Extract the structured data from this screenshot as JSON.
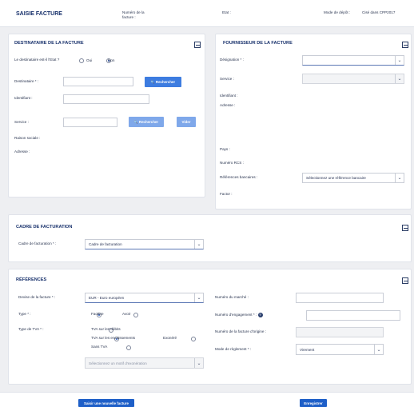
{
  "header": {
    "title": "SAISIE FACTURE",
    "invoice_number_label": "Numéro de la facture :",
    "status_label": "Etat :",
    "deposit_mode_label": "Mode de dépôt :",
    "deposit_mode_value": "Cisé dans CPP2017"
  },
  "destinataire": {
    "title": "DESTINATAIRE DE LA FACTURE",
    "is_state_label": "Le destinataire est-il l'Etat ?",
    "oui": "Oui",
    "non": "Non",
    "is_state_selected": "Non",
    "destinataire_label": "Destinataire * :",
    "search_button": "Rechercher",
    "identifiant_label": "Identifiant :",
    "service_label": "Service :",
    "service_search_button": "Rechercher",
    "vider_button": "Vider",
    "raison_sociale_label": "Raison sociale :",
    "adresse_label": "Adresse :"
  },
  "fournisseur": {
    "title": "FOURNISSEUR DE LA FACTURE",
    "designation_label": "Désignation * :",
    "service_label": "Service :",
    "identifiant_label": "Identifiant :",
    "adresse_label": "Adresse :",
    "pays_label": "Pays :",
    "rcs_label": "Numéro RCS :",
    "bank_label": "Références bancaires :",
    "bank_placeholder": "Sélectionnez une référence bancaire",
    "factor_label": "Factor :"
  },
  "cadre": {
    "title": "CADRE DE FACTURATION",
    "label": "Cadre de facturation * :",
    "value": "Cadre de facturation"
  },
  "references": {
    "title": "RÉFÉRENCES",
    "devise_label": "Devise de la facture * :",
    "devise_value": "EUR - Euro européen",
    "type_label": "Type * :",
    "type_facture": "Facture",
    "type_avoir": "Avoir",
    "type_selected": "Facture",
    "tva_label": "Type de TVA * :",
    "tva_debits": "TVA sur les débits",
    "tva_encaissements": "TVA sur les encaissements",
    "tva_exonere": "Exonéré",
    "tva_sans": "Sans TVA",
    "tva_selected": "TVA sur les encaissements",
    "exoneration_placeholder": "Sélectionnez un motif d'exonération",
    "marche_label": "Numéro du marché :",
    "engagement_label": "Numéro d'engagement * :",
    "origine_label": "Numéro de la facture d'origine :",
    "reglement_label": "Mode de règlement * :",
    "reglement_value": "Virement"
  },
  "footer": {
    "new_invoice_button": "Saisir une nouvelle facture",
    "save_button": "Enregistrer"
  },
  "icons": {
    "search": "🔍",
    "caret": "⌄",
    "info": "?"
  },
  "colors": {
    "primary_button": "#3d7ce0",
    "title": "#17306b",
    "background": "#eeeff2"
  }
}
